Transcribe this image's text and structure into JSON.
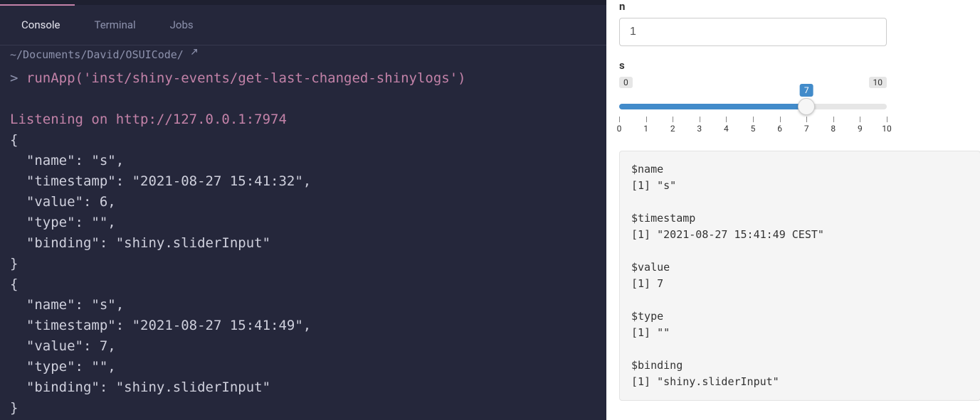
{
  "console": {
    "tabs": {
      "console": "Console",
      "terminal": "Terminal",
      "jobs": "Jobs"
    },
    "path": "~/Documents/David/OSUICode/",
    "path_icon": "share-icon",
    "prompt": ">",
    "command": "runApp('inst/shiny-events/get-last-changed-shinylogs')",
    "listening": "Listening on http://127.0.0.1:7974",
    "json_output": "{\n  \"name\": \"s\",\n  \"timestamp\": \"2021-08-27 15:41:32\",\n  \"value\": 6,\n  \"type\": \"\",\n  \"binding\": \"shiny.sliderInput\"\n}\n{\n  \"name\": \"s\",\n  \"timestamp\": \"2021-08-27 15:41:49\",\n  \"value\": 7,\n  \"type\": \"\",\n  \"binding\": \"shiny.sliderInput\"\n}"
  },
  "app": {
    "n": {
      "label": "n",
      "value": "1"
    },
    "s": {
      "label": "s",
      "min": "0",
      "max": "10",
      "value": "7",
      "value_num": 7,
      "ticks": [
        "0",
        "1",
        "2",
        "3",
        "4",
        "5",
        "6",
        "7",
        "8",
        "9",
        "10"
      ]
    },
    "output": "$name\n[1] \"s\"\n\n$timestamp\n[1] \"2021-08-27 15:41:49 CEST\"\n\n$value\n[1] 7\n\n$type\n[1] \"\"\n\n$binding\n[1] \"shiny.sliderInput\""
  }
}
